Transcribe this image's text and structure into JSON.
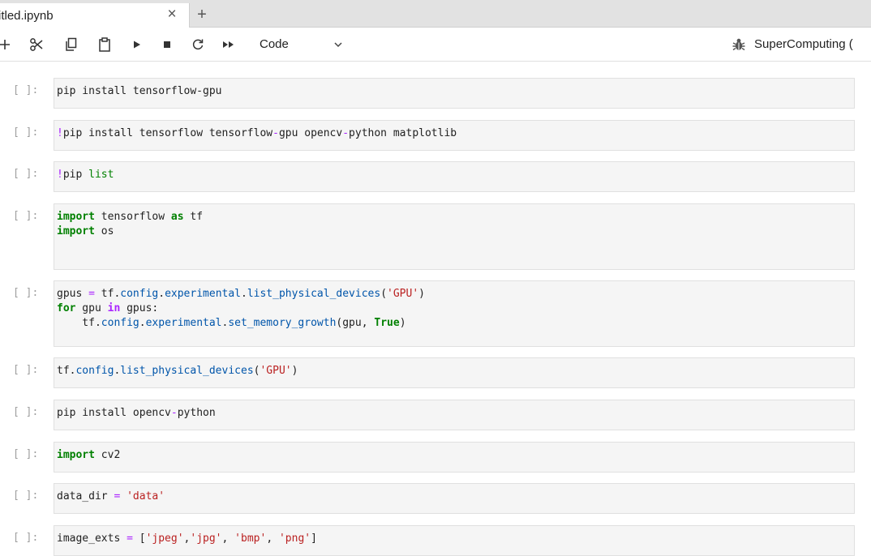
{
  "tab": {
    "title": "itled.ipynb",
    "close": "×",
    "add": "+"
  },
  "toolbar": {
    "buttons": [
      {
        "name": "add-cell-button",
        "icon": "plus-icon"
      },
      {
        "name": "cut-button",
        "icon": "scissors-icon"
      },
      {
        "name": "copy-button",
        "icon": "copy-icon"
      },
      {
        "name": "paste-button",
        "icon": "clipboard-icon"
      },
      {
        "name": "run-button",
        "icon": "play-icon"
      },
      {
        "name": "interrupt-button",
        "icon": "stop-icon"
      },
      {
        "name": "restart-button",
        "icon": "refresh-icon"
      },
      {
        "name": "restart-run-all-button",
        "icon": "fast-forward-icon"
      }
    ],
    "cell_type": "Code",
    "kernel_name": "SuperComputing ("
  },
  "cells": [
    {
      "prompt": "[ ]:",
      "tokens": [
        [
          "t",
          "pip install tensorflow-gpu"
        ]
      ]
    },
    {
      "prompt": "[ ]:",
      "tokens": [
        [
          "mag",
          "!"
        ],
        [
          "t",
          "pip install tensorflow tensorflow"
        ],
        [
          "eq",
          "-"
        ],
        [
          "t",
          "gpu opencv"
        ],
        [
          "eq",
          "-"
        ],
        [
          "t",
          "python matplotlib"
        ]
      ]
    },
    {
      "prompt": "[ ]:",
      "tokens": [
        [
          "mag",
          "!"
        ],
        [
          "t",
          "pip "
        ],
        [
          "bi",
          "list"
        ]
      ]
    },
    {
      "prompt": "[ ]:",
      "tokens": [
        [
          "kw",
          "import"
        ],
        [
          "t",
          " tensorflow "
        ],
        [
          "kw",
          "as"
        ],
        [
          "t",
          " tf\n"
        ],
        [
          "kw",
          "import"
        ],
        [
          "t",
          " os\n "
        ]
      ]
    },
    {
      "prompt": "[ ]:",
      "tokens": [
        [
          "t",
          "gpus "
        ],
        [
          "eq",
          "="
        ],
        [
          "t",
          " tf"
        ],
        [
          "t",
          "."
        ],
        [
          "attr",
          "config"
        ],
        [
          "t",
          "."
        ],
        [
          "attr",
          "experimental"
        ],
        [
          "t",
          "."
        ],
        [
          "attr",
          "list_physical_devices"
        ],
        [
          "t",
          "("
        ],
        [
          "str",
          "'GPU'"
        ],
        [
          "t",
          ")\n"
        ],
        [
          "kw",
          "for"
        ],
        [
          "t",
          " gpu "
        ],
        [
          "op",
          "in"
        ],
        [
          "t",
          " gpus:\n    tf"
        ],
        [
          "t",
          "."
        ],
        [
          "attr",
          "config"
        ],
        [
          "t",
          "."
        ],
        [
          "attr",
          "experimental"
        ],
        [
          "t",
          "."
        ],
        [
          "attr",
          "set_memory_growth"
        ],
        [
          "t",
          "(gpu, "
        ],
        [
          "kw",
          "True"
        ],
        [
          "t",
          ")"
        ]
      ]
    },
    {
      "prompt": "[ ]:",
      "tokens": [
        [
          "t",
          "tf"
        ],
        [
          "t",
          "."
        ],
        [
          "attr",
          "config"
        ],
        [
          "t",
          "."
        ],
        [
          "attr",
          "list_physical_devices"
        ],
        [
          "t",
          "("
        ],
        [
          "str",
          "'GPU'"
        ],
        [
          "t",
          ")"
        ]
      ]
    },
    {
      "prompt": "[ ]:",
      "tokens": [
        [
          "t",
          "pip install opencv"
        ],
        [
          "eq",
          "-"
        ],
        [
          "t",
          "python"
        ]
      ]
    },
    {
      "prompt": "[ ]:",
      "tokens": [
        [
          "kw",
          "import"
        ],
        [
          "t",
          " cv2"
        ]
      ]
    },
    {
      "prompt": "[ ]:",
      "tokens": [
        [
          "t",
          "data_dir "
        ],
        [
          "eq",
          "="
        ],
        [
          "t",
          " "
        ],
        [
          "str",
          "'data'"
        ]
      ]
    },
    {
      "prompt": "[ ]:",
      "tokens": [
        [
          "t",
          "image_exts "
        ],
        [
          "eq",
          "="
        ],
        [
          "t",
          " ["
        ],
        [
          "str",
          "'jpeg'"
        ],
        [
          "t",
          ","
        ],
        [
          "str",
          "'jpg'"
        ],
        [
          "t",
          ", "
        ],
        [
          "str",
          "'bmp'"
        ],
        [
          "t",
          ", "
        ],
        [
          "str",
          "'png'"
        ],
        [
          "t",
          "]"
        ]
      ]
    }
  ]
}
